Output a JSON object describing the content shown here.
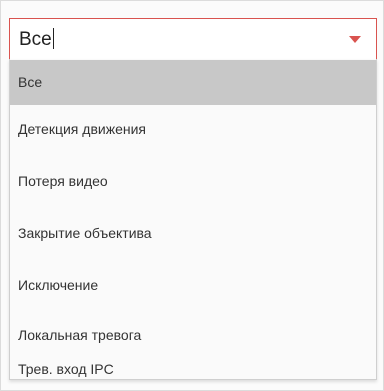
{
  "select": {
    "value": "Все",
    "accent_color": "#d9534f"
  },
  "options": [
    "Все",
    "Детекция движения",
    "Потеря видео",
    "Закрытие объектива",
    "Исключение",
    "Локальная тревога",
    "Трев. вход IPC"
  ],
  "selected_index": 0
}
